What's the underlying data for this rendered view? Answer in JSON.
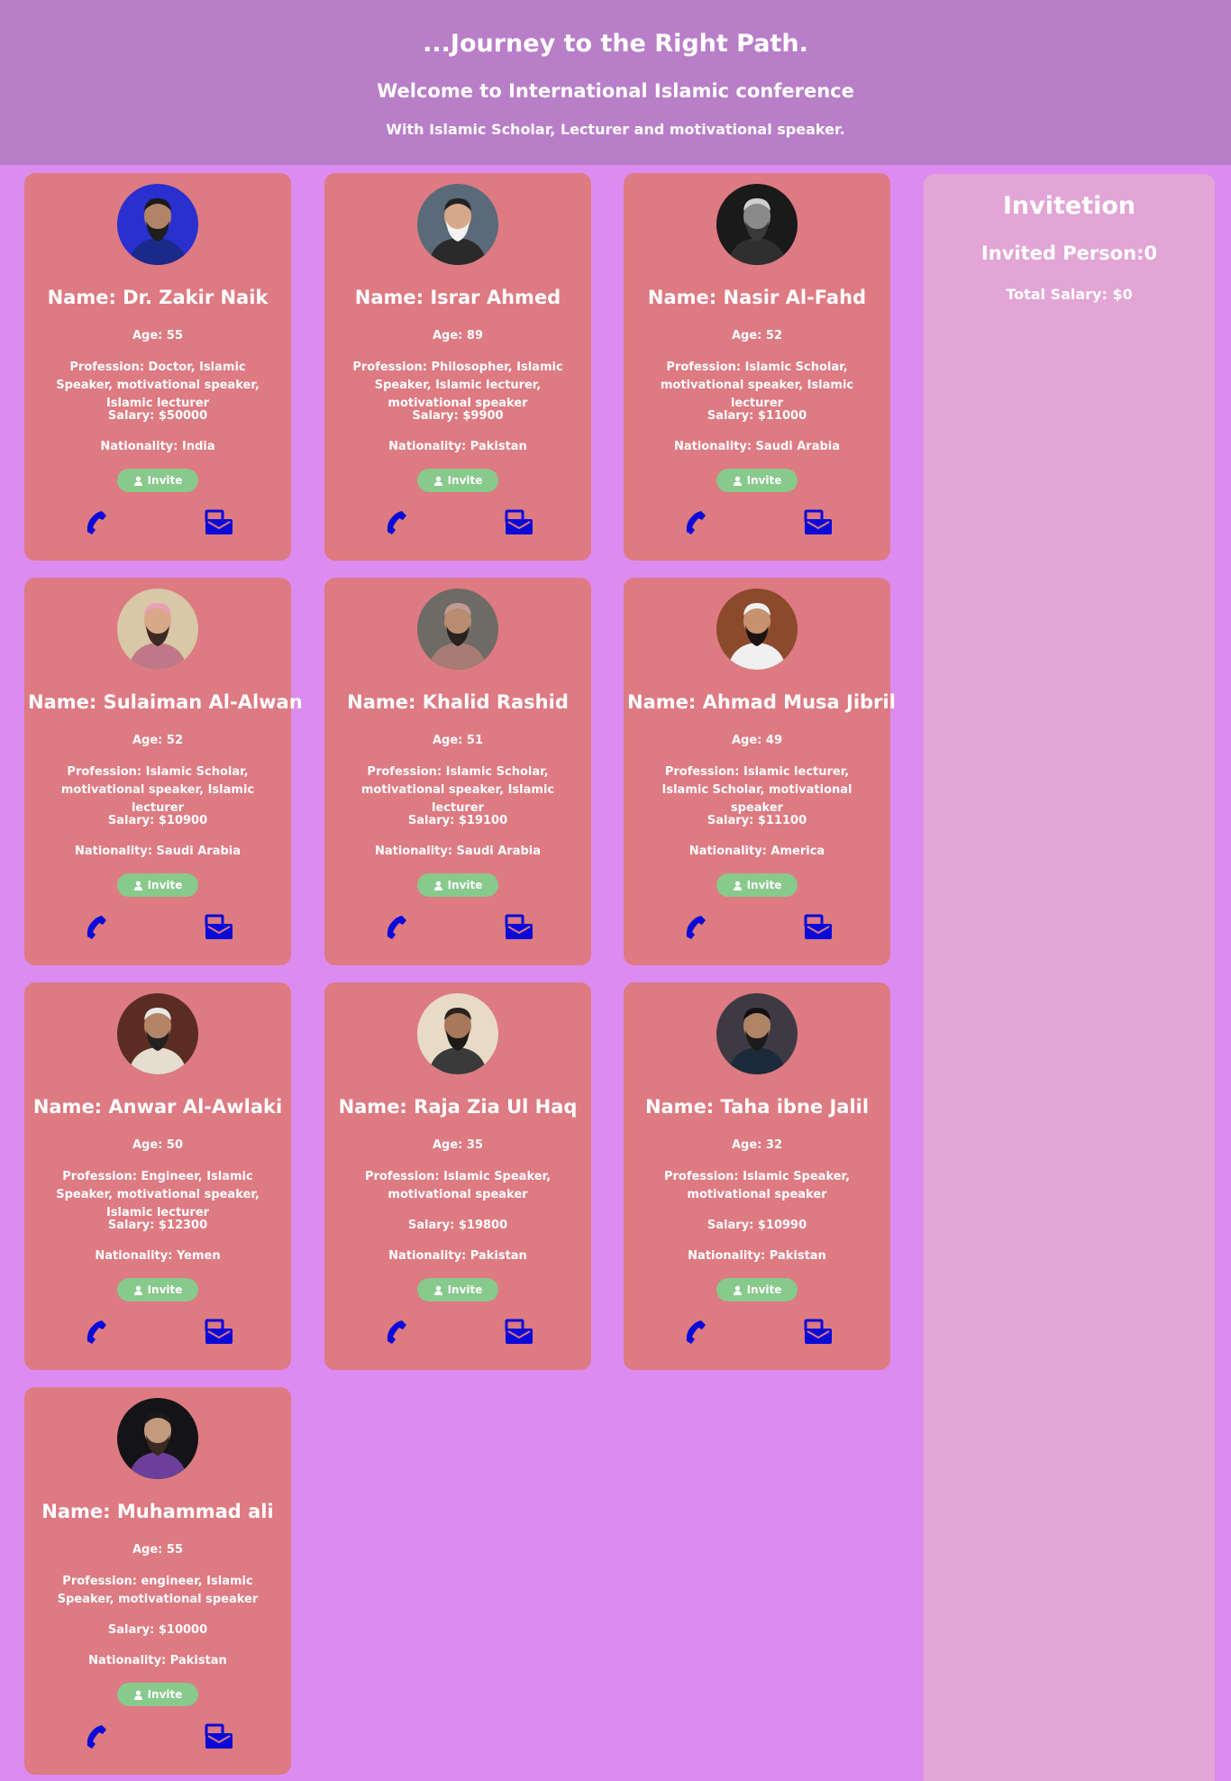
{
  "header": {
    "tagline": "...Journey to the Right Path.",
    "welcome": "Welcome to International Islamic conference",
    "subtitle": "With Islamic Scholar, Lecturer and motivational speaker."
  },
  "cards": [
    {
      "name": "Name: Dr. Zakir Naik",
      "age": "Age: 55",
      "profession": "Profession: Doctor, Islamic Speaker, motivational speaker, Islamic lecturer",
      "salary": "Salary: $50000",
      "nationality": "Nationality: India",
      "invite_label": "Invite"
    },
    {
      "name": "Name: Israr Ahmed",
      "age": "Age: 89",
      "profession": "Profession: Philosopher, Islamic Speaker, Islamic lecturer, motivational speaker",
      "salary": "Salary: $9900",
      "nationality": "Nationality: Pakistan",
      "invite_label": "Invite"
    },
    {
      "name": "Name: Nasir Al-Fahd",
      "age": "Age: 52",
      "profession": "Profession: Islamic Scholar, motivational speaker, Islamic lecturer",
      "salary": "Salary: $11000",
      "nationality": "Nationality: Saudi Arabia",
      "invite_label": "Invite"
    },
    {
      "name": "Name: Sulaiman Al-Alwan",
      "age": "Age: 52",
      "profession": "Profession: Islamic Scholar, motivational speaker, Islamic lecturer",
      "salary": "Salary: $10900",
      "nationality": "Nationality: Saudi Arabia",
      "invite_label": "Invite"
    },
    {
      "name": "Name: Khalid Rashid",
      "age": "Age: 51",
      "profession": "Profession: Islamic Scholar, motivational speaker, Islamic lecturer",
      "salary": "Salary: $19100",
      "nationality": "Nationality: Saudi Arabia",
      "invite_label": "Invite"
    },
    {
      "name": "Name: Ahmad Musa Jibril",
      "age": "Age: 49",
      "profession": "Profession: Islamic lecturer, Islamic Scholar, motivational speaker",
      "salary": "Salary: $11100",
      "nationality": "Nationality: America",
      "invite_label": "Invite"
    },
    {
      "name": "Name: Anwar Al-Awlaki",
      "age": "Age: 50",
      "profession": "Profession: Engineer, Islamic Speaker, motivational speaker, Islamic lecturer",
      "salary": "Salary: $12300",
      "nationality": "Nationality: Yemen",
      "invite_label": "Invite"
    },
    {
      "name": "Name: Raja Zia Ul Haq",
      "age": "Age: 35",
      "profession": "Profession: Islamic Speaker, motivational speaker",
      "salary": "Salary: $19800",
      "nationality": "Nationality: Pakistan",
      "invite_label": "Invite"
    },
    {
      "name": "Name: Taha ibne Jalil",
      "age": "Age: 32",
      "profession": "Profession: Islamic Speaker, motivational speaker",
      "salary": "Salary: $10990",
      "nationality": "Nationality: Pakistan",
      "invite_label": "Invite"
    },
    {
      "name": "Name: Muhammad ali",
      "age": "Age: 55",
      "profession": "Profession: engineer, Islamic Speaker, motivational speaker",
      "salary": "Salary: $10000",
      "nationality": "Nationality: Pakistan",
      "invite_label": "Invite"
    }
  ],
  "invitation": {
    "title": "Invitetion",
    "invited_person": "Invited Person:0",
    "total_salary": "Total Salary: $0"
  },
  "icons": {
    "invite": "user-icon",
    "call": "phone-icon",
    "message": "mail-icon"
  },
  "colors": {
    "page_background": "#dc8cf0",
    "header_background": "#b97ec8",
    "card_background": "#dd7a82",
    "invite_button": "#88c98c",
    "contact_icon": "#0a0ad8",
    "panel_background": "#e2a5d6"
  }
}
